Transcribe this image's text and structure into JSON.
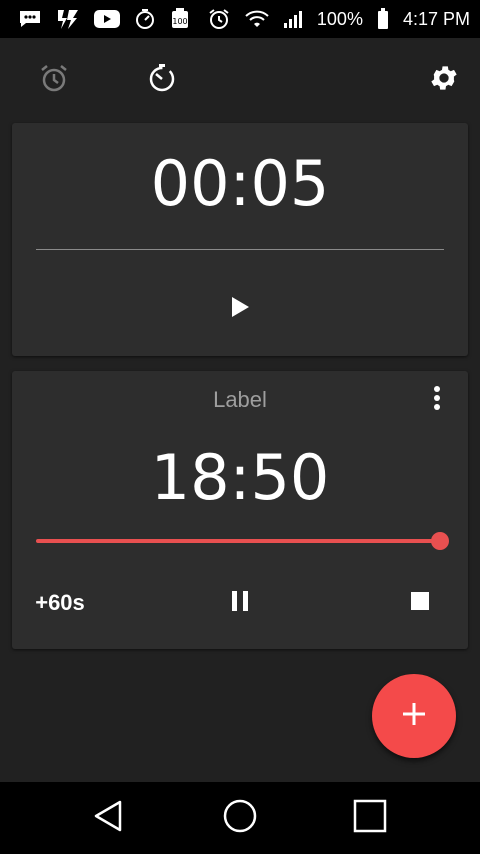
{
  "status_bar": {
    "battery_text": "100%",
    "time": "4:17 PM",
    "icons": [
      "messages-icon",
      "bolt-app-icon",
      "youtube-icon",
      "timer-icon",
      "storage-icon",
      "alarm-icon",
      "wifi-icon",
      "signal-icon",
      "battery-icon"
    ]
  },
  "app_bar": {
    "tabs": [
      {
        "icon": "alarm-clock-icon",
        "active": false
      },
      {
        "icon": "timer-icon",
        "active": true
      }
    ],
    "settings_icon": "gear-icon"
  },
  "timers": [
    {
      "time": "00:05",
      "state": "stopped",
      "label": "",
      "primary_action_icon": "play-icon"
    },
    {
      "time": "18:50",
      "state": "running",
      "label": "Label",
      "progress_fraction": 1.0,
      "add_time_label": "+60s",
      "primary_action_icon": "pause-icon",
      "stop_icon": "stop-icon",
      "menu_icon": "more-vert-icon"
    }
  ],
  "fab": {
    "icon": "plus-icon",
    "color": "#f44a4a"
  },
  "colors": {
    "accent": "#e85050",
    "background": "#212121",
    "card": "#2d2d2d"
  },
  "nav_bar": {
    "buttons": [
      "back-icon",
      "home-icon",
      "recents-icon"
    ]
  }
}
